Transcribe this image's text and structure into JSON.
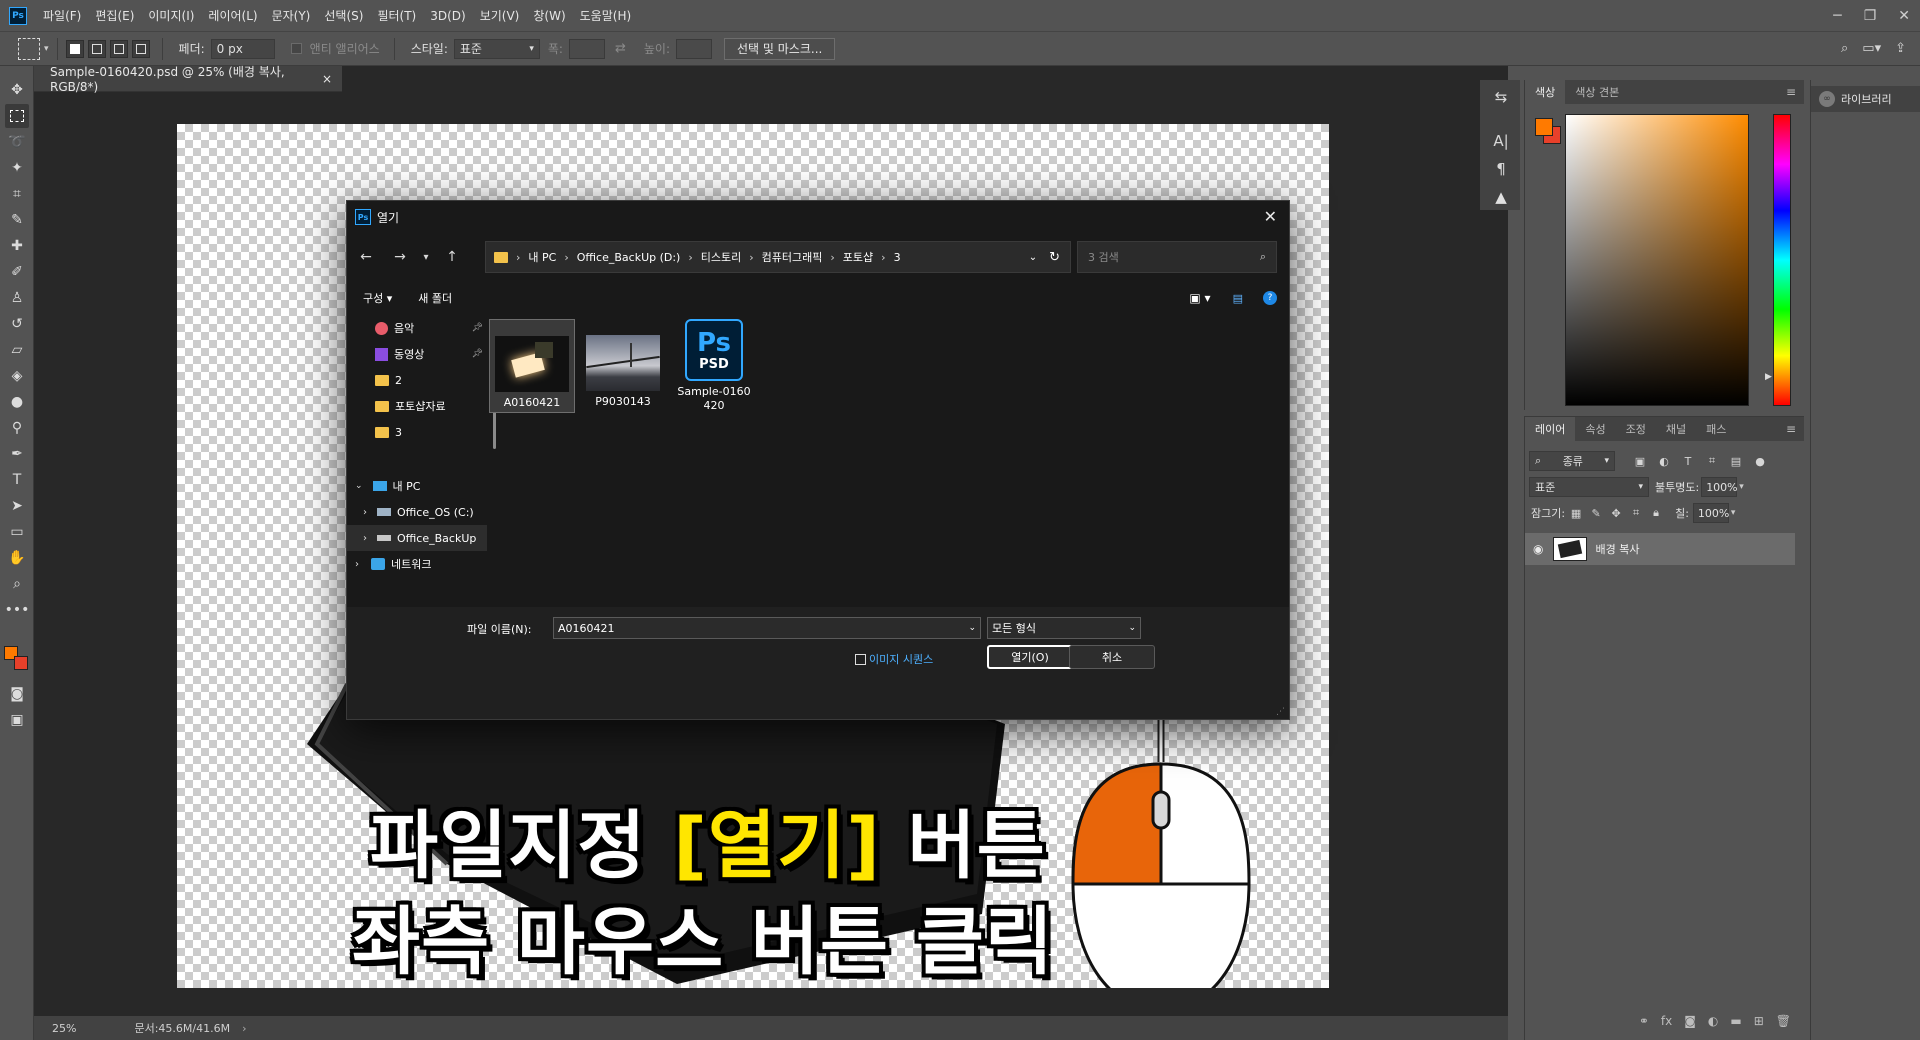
{
  "app": {
    "logo": "Ps",
    "menu": [
      "파일(F)",
      "편집(E)",
      "이미지(I)",
      "레이어(L)",
      "문자(Y)",
      "선택(S)",
      "필터(T)",
      "3D(D)",
      "보기(V)",
      "창(W)",
      "도움말(H)"
    ]
  },
  "window_controls": {
    "minimize": "─",
    "restore": "❐",
    "close": "✕"
  },
  "options_bar": {
    "feather_label": "페더:",
    "feather_value": "0 px",
    "antialias_label": "앤티 앨리어스",
    "style_label": "스타일:",
    "style_value": "표준",
    "width_label": "폭:",
    "height_label": "높이:",
    "select_mask_button": "선택 및 마스크..."
  },
  "document": {
    "tab_title": "Sample-0160420.psd @ 25% (배경 복사, RGB/8*)",
    "tab_close": "×",
    "zoom": "25%",
    "doc_info": "문서:45.6M/41.6M"
  },
  "dialog": {
    "title": "열기",
    "close": "✕",
    "breadcrumb": [
      "내 PC",
      "Office_BackUp (D:)",
      "티스토리",
      "컴퓨터그래픽",
      "포토샵",
      "3"
    ],
    "search_placeholder": "3 검색",
    "organize_label": "구성 ▾",
    "new_folder_label": "새 폴더",
    "sidebar": [
      {
        "label": "음악",
        "icon": "music-icon",
        "pinned": true
      },
      {
        "label": "동영상",
        "icon": "video-icon",
        "pinned": true
      },
      {
        "label": "2",
        "icon": "folder-icon"
      },
      {
        "label": "포토샵자료",
        "icon": "folder-icon"
      },
      {
        "label": "3",
        "icon": "folder-icon"
      },
      {
        "label": "내 PC",
        "icon": "pc-icon"
      },
      {
        "label": "Office_OS (C:)",
        "icon": "drive-icon"
      },
      {
        "label": "Office_BackUp",
        "icon": "drive-icon"
      },
      {
        "label": "네트워크",
        "icon": "network-icon"
      }
    ],
    "files": [
      {
        "name": "A0160421",
        "selected": true
      },
      {
        "name": "P9030143",
        "selected": false
      },
      {
        "name": "Sample-0160420",
        "selected": false
      }
    ],
    "psd_badge": {
      "top": "Ps",
      "bottom": "PSD"
    },
    "filename_label": "파일 이름(N):",
    "filename_value": "A0160421",
    "filetype_value": "모든 형식",
    "image_sequence_label": "이미지 시퀀스",
    "open_button": "열기(O)",
    "cancel_button": "취소"
  },
  "overlay": {
    "line1_prefix": "파일지정 ",
    "line1_highlight": "[열기]",
    "line1_suffix": " 버튼",
    "line2": "좌측 마우스 버튼 클릭"
  },
  "color_panel": {
    "tabs": [
      "색상",
      "색상 견본"
    ],
    "foreground": "#ff7a00",
    "background": "#e8402a"
  },
  "layers_panel": {
    "tabs": [
      "레이어",
      "속성",
      "조정",
      "채널",
      "패스"
    ],
    "filter_label": "종류",
    "blend_mode": "표준",
    "opacity_label": "불투명도:",
    "opacity_value": "100%",
    "lock_label": "잠그기:",
    "fill_label": "칠:",
    "fill_value": "100%",
    "layers": [
      {
        "name": "배경 복사",
        "visible": true
      }
    ]
  },
  "libraries_panel": {
    "title": "라이브러리"
  },
  "colors": {
    "accent_orange": "#e8650a",
    "highlight_yellow": "#ffe600"
  }
}
